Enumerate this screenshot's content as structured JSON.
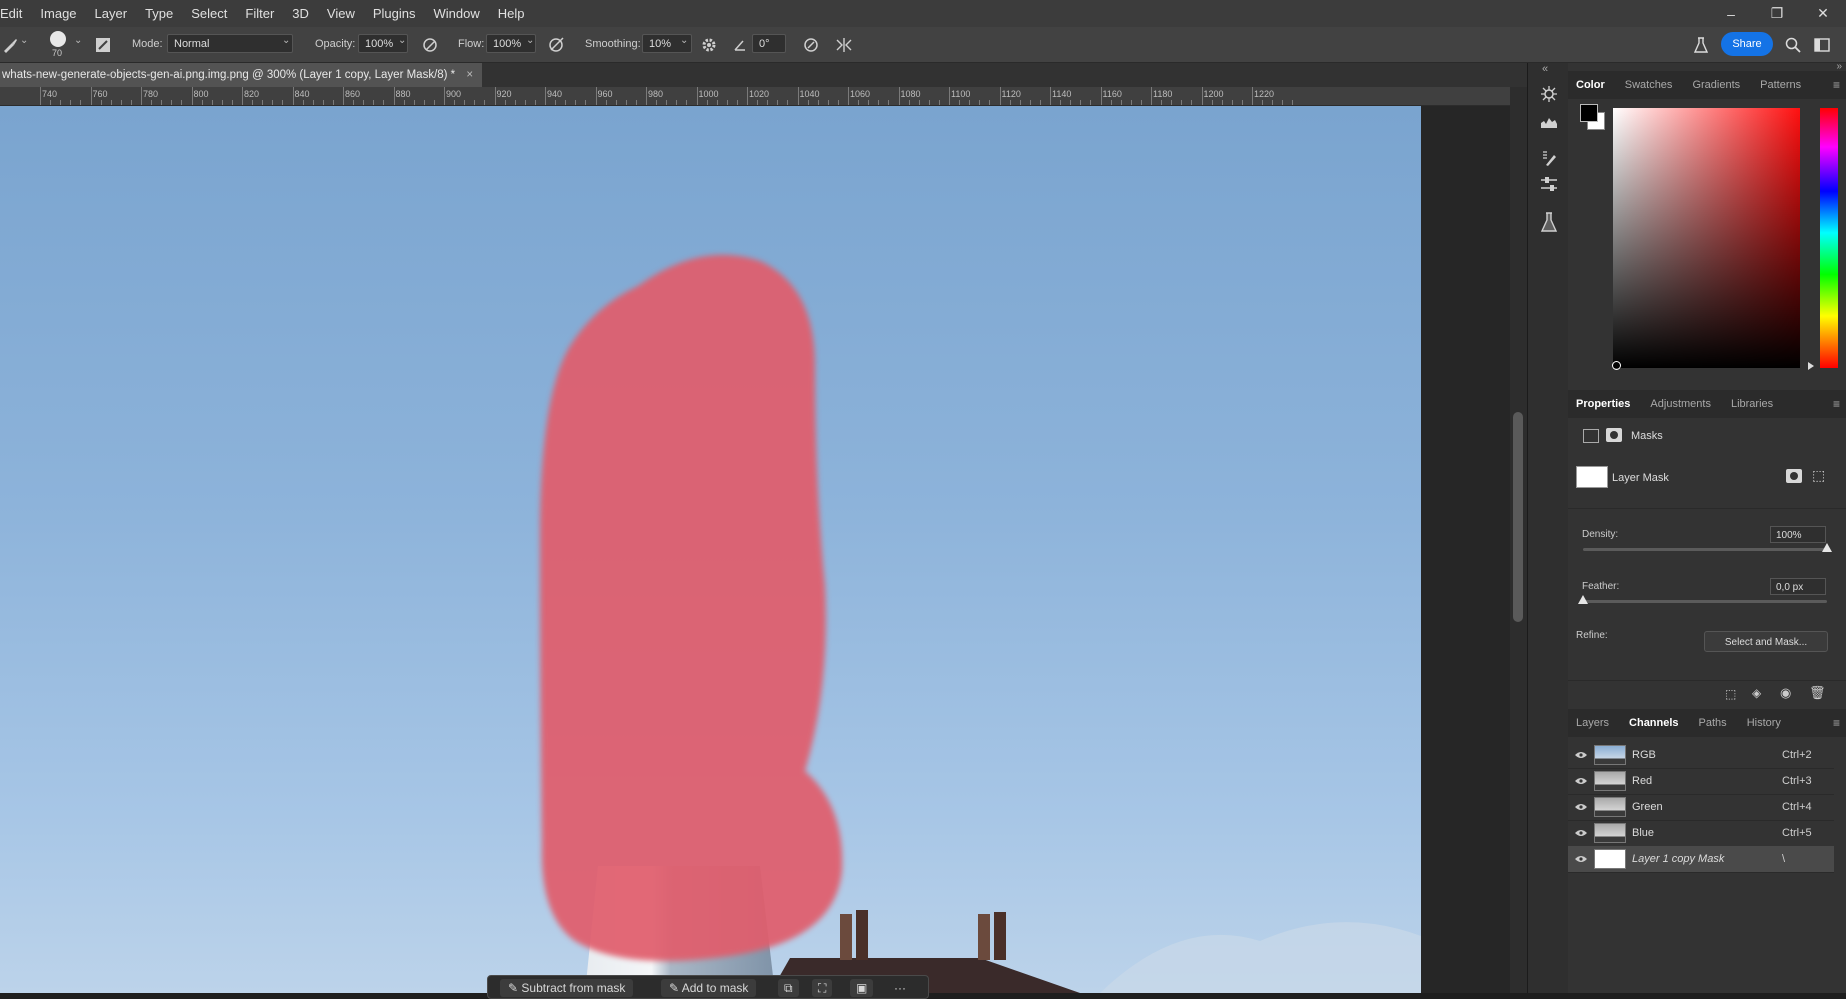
{
  "menu": {
    "items": [
      "Edit",
      "Image",
      "Layer",
      "Type",
      "Select",
      "Filter",
      "3D",
      "View",
      "Plugins",
      "Window",
      "Help"
    ]
  },
  "window_controls": {
    "minimize": "–",
    "restore": "❐",
    "close": "✕"
  },
  "options": {
    "brush_size": "70",
    "mode_label": "Mode:",
    "mode_value": "Normal",
    "opacity_label": "Opacity:",
    "opacity_value": "100%",
    "flow_label": "Flow:",
    "flow_value": "100%",
    "smoothing_label": "Smoothing:",
    "smoothing_value": "10%",
    "angle_value": "0°",
    "share_label": "Share"
  },
  "document": {
    "tab_title": "whats-new-generate-objects-gen-ai.png.img.png @ 300% (Layer 1 copy, Layer Mask/8) *",
    "close": "×",
    "ruler_labels": [
      "740",
      "760",
      "780",
      "800",
      "820",
      "840",
      "860",
      "880",
      "900",
      "920",
      "940",
      "960",
      "980",
      "1000",
      "1020",
      "1040",
      "1060",
      "1080",
      "1100",
      "1120",
      "1140",
      "1160",
      "1180",
      "1200",
      "1220"
    ]
  },
  "color_panel": {
    "tabs": [
      "Color",
      "Swatches",
      "Gradients",
      "Patterns"
    ],
    "active_tab": "Color",
    "foreground": "#000000",
    "background": "#ffffff",
    "hue_color": "#ff1010"
  },
  "properties_panel": {
    "tabs": [
      "Properties",
      "Adjustments",
      "Libraries"
    ],
    "active_tab": "Properties",
    "section": "Masks",
    "mask_label": "Layer Mask",
    "density_label": "Density:",
    "density_value": "100%",
    "density_fraction": 1.0,
    "feather_label": "Feather:",
    "feather_value": "0,0 px",
    "feather_fraction": 0.0,
    "refine_label": "Refine:",
    "select_and_mask": "Select and Mask..."
  },
  "channels_panel": {
    "tabs": [
      "Layers",
      "Channels",
      "Paths",
      "History"
    ],
    "active_tab": "Channels",
    "rows": [
      {
        "name": "RGB",
        "shortcut": "Ctrl+2"
      },
      {
        "name": "Red",
        "shortcut": "Ctrl+3"
      },
      {
        "name": "Green",
        "shortcut": "Ctrl+4"
      },
      {
        "name": "Blue",
        "shortcut": "Ctrl+5"
      },
      {
        "name": "Layer 1 copy Mask",
        "shortcut": "\\"
      }
    ]
  },
  "context_bar": {
    "subtract_label": "Subtract from mask",
    "add_label": "Add to mask",
    "more": "···"
  },
  "colors": {
    "accent": "#1473e6",
    "mask_overlay": "#e06070"
  }
}
